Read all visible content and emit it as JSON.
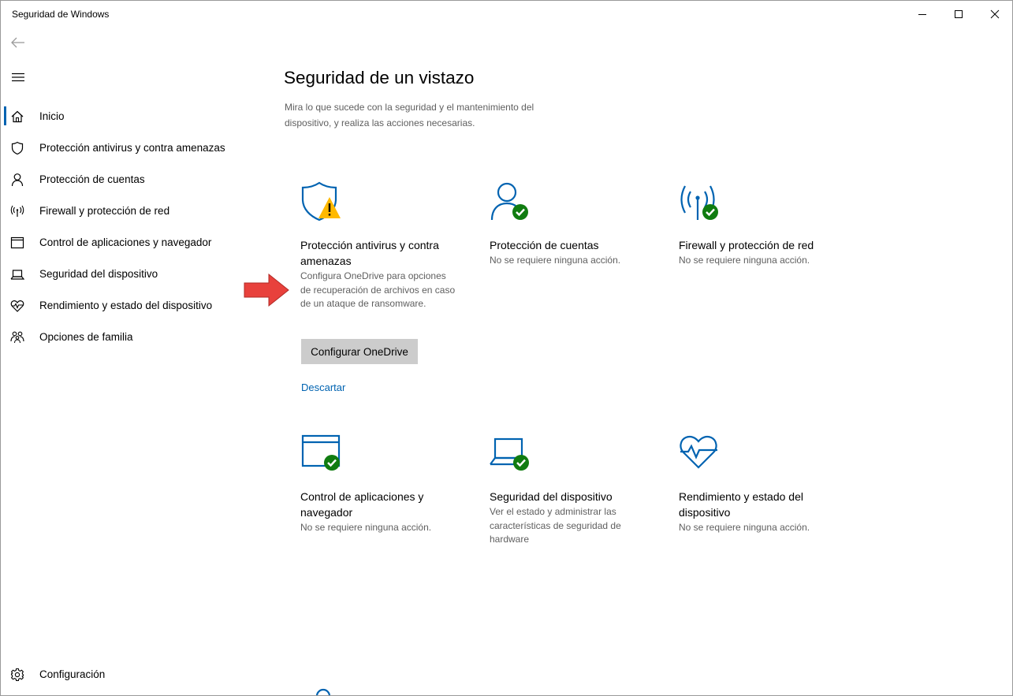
{
  "window": {
    "title": "Seguridad de Windows"
  },
  "nav": {
    "items": [
      {
        "label": "Inicio",
        "icon": "home-icon",
        "active": true
      },
      {
        "label": "Protección antivirus y contra amenazas",
        "icon": "shield-icon"
      },
      {
        "label": "Protección de cuentas",
        "icon": "person-icon"
      },
      {
        "label": "Firewall y protección de red",
        "icon": "antenna-icon"
      },
      {
        "label": "Control de aplicaciones y navegador",
        "icon": "browser-window-icon"
      },
      {
        "label": "Seguridad del dispositivo",
        "icon": "laptop-icon"
      },
      {
        "label": "Rendimiento y estado del dispositivo",
        "icon": "heart-pulse-icon"
      },
      {
        "label": "Opciones de familia",
        "icon": "family-icon"
      }
    ],
    "settings_label": "Configuración"
  },
  "main": {
    "title": "Seguridad de un vistazo",
    "description": "Mira lo que sucede con la seguridad y el mantenimiento del dispositivo, y realiza las acciones necesarias.",
    "tiles": [
      {
        "title": "Protección antivirus y contra amenazas",
        "description": "Configura OneDrive para opciones de recuperación de archivos en caso de un ataque de ransomware.",
        "status": "warning",
        "button_label": "Configurar OneDrive",
        "link_label": "Descartar"
      },
      {
        "title": "Protección de cuentas",
        "description": "No se requiere ninguna acción.",
        "status": "ok"
      },
      {
        "title": "Firewall y protección de red",
        "description": "No se requiere ninguna acción.",
        "status": "ok"
      },
      {
        "title": "Control de aplicaciones y navegador",
        "description": "No se requiere ninguna acción.",
        "status": "ok"
      },
      {
        "title": "Seguridad del dispositivo",
        "description": "Ver el estado y administrar las características de seguridad de hardware",
        "status": "ok"
      },
      {
        "title": "Rendimiento y estado del dispositivo",
        "description": "No se requiere ninguna acción.",
        "status": "ok"
      }
    ]
  },
  "colors": {
    "accent": "#0063b1",
    "ok": "#107c10",
    "warning": "#ffb900",
    "annotation_arrow": "#e8413c"
  }
}
